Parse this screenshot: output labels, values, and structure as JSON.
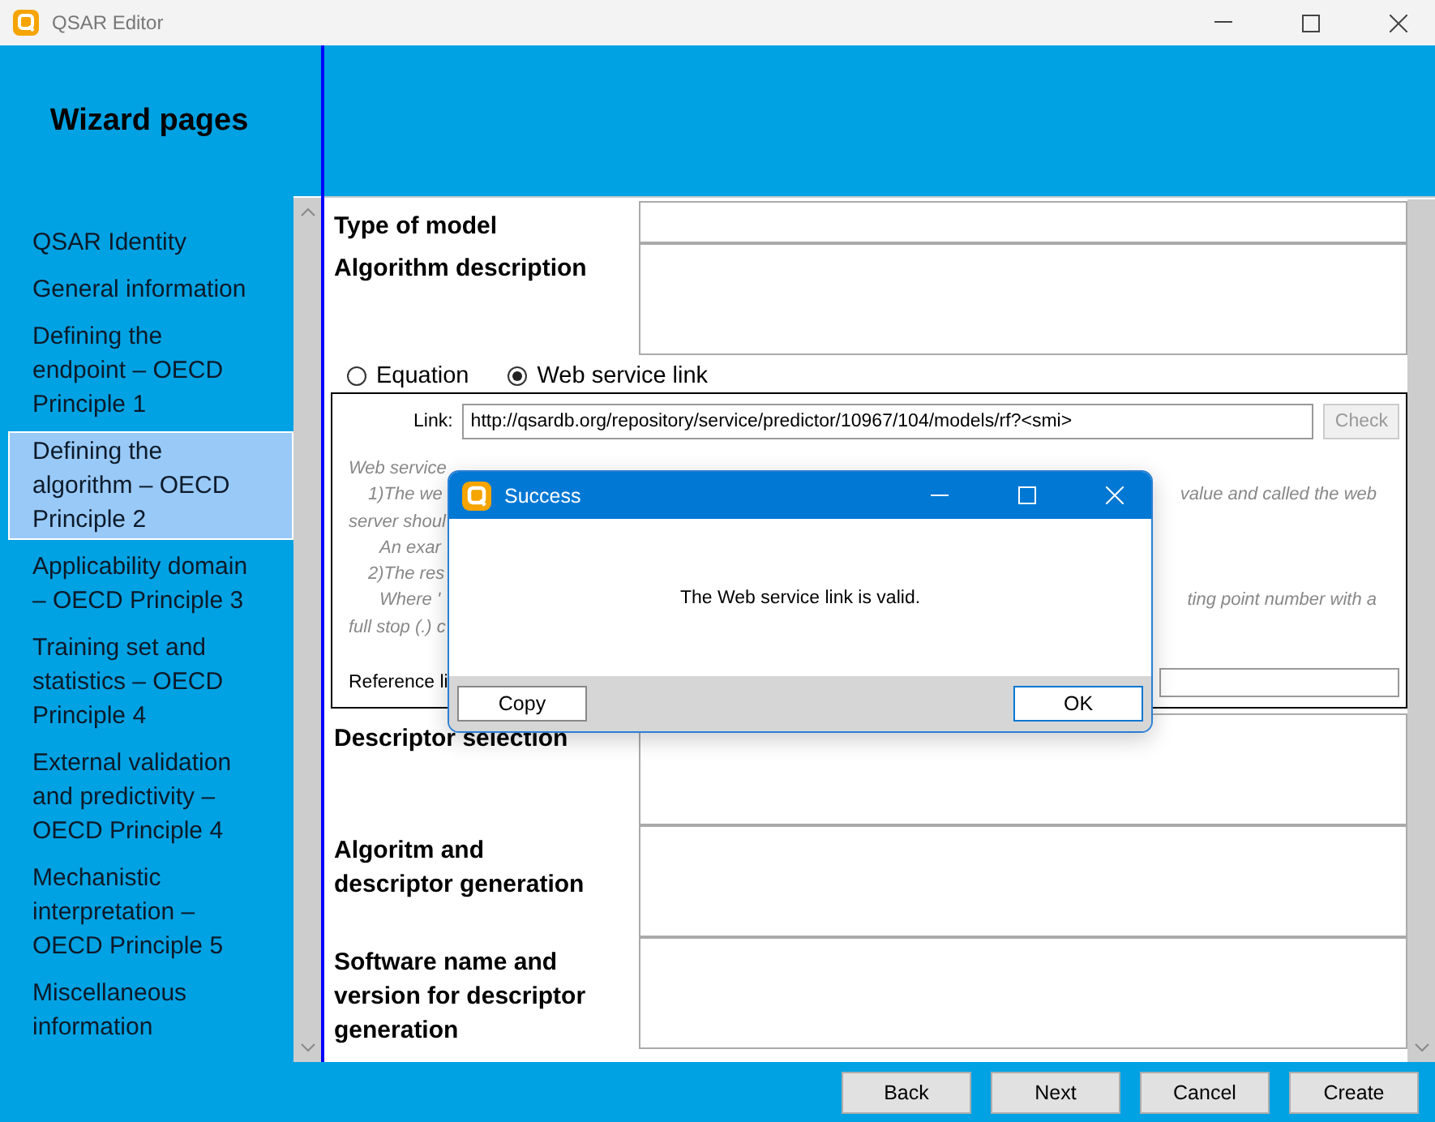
{
  "window": {
    "title": "QSAR Editor"
  },
  "sidebar": {
    "title": "Wizard pages",
    "items": [
      {
        "label": "QSAR Identity",
        "selected": false
      },
      {
        "label": "General information",
        "selected": false
      },
      {
        "label": "Defining the endpoint – OECD Principle 1",
        "selected": false
      },
      {
        "label": "Defining the algorithm – OECD Principle 2",
        "selected": true
      },
      {
        "label": "Applicability domain – OECD Principle 3",
        "selected": false
      },
      {
        "label": "Training set and statistics – OECD Principle 4",
        "selected": false
      },
      {
        "label": "External validation and predictivity – OECD Principle 4",
        "selected": false
      },
      {
        "label": "Mechanistic interpretation – OECD Principle 5",
        "selected": false
      },
      {
        "label": "Miscellaneous information",
        "selected": false
      }
    ]
  },
  "form": {
    "fields_top": [
      {
        "label": "Type of model",
        "kind": "line"
      },
      {
        "label": "Algorithm description",
        "kind": "area"
      }
    ],
    "method_options": [
      {
        "label": "Equation",
        "selected": false
      },
      {
        "label": "Web service link",
        "selected": true
      }
    ],
    "web_service": {
      "link_label": "Link:",
      "link_value": "http://qsardb.org/repository/service/predictor/10967/104/models/rf?<smi>",
      "check_button": {
        "label": "Check",
        "disabled": true
      },
      "help_lines": [
        {
          "left": "Web service",
          "kind": "plain"
        },
        {
          "left": "1)The we",
          "right": "value and called the web",
          "kind": "step"
        },
        {
          "left": "server shoul",
          "kind": "plain"
        },
        {
          "left": "An exar",
          "kind": "detail"
        },
        {
          "left": "2)The res",
          "kind": "step"
        },
        {
          "left": "Where '",
          "right": "ting point number with a",
          "kind": "detail"
        },
        {
          "left": "full stop (.) c",
          "kind": "plain"
        }
      ],
      "reference_label": "Reference li"
    },
    "fields_bottom": [
      {
        "label": "Descriptor selection",
        "kind": "area"
      },
      {
        "label": "Algoritm and descriptor generation",
        "kind": "area"
      },
      {
        "label": "Software name and version for descriptor generation",
        "kind": "area"
      }
    ]
  },
  "dialog": {
    "title": "Success",
    "message": "The Web service link is valid.",
    "buttons": [
      {
        "label": "Copy",
        "kind": "left"
      },
      {
        "label": "OK",
        "kind": "right"
      }
    ]
  },
  "buttons": [
    "Back",
    "Next",
    "Cancel",
    "Create"
  ]
}
